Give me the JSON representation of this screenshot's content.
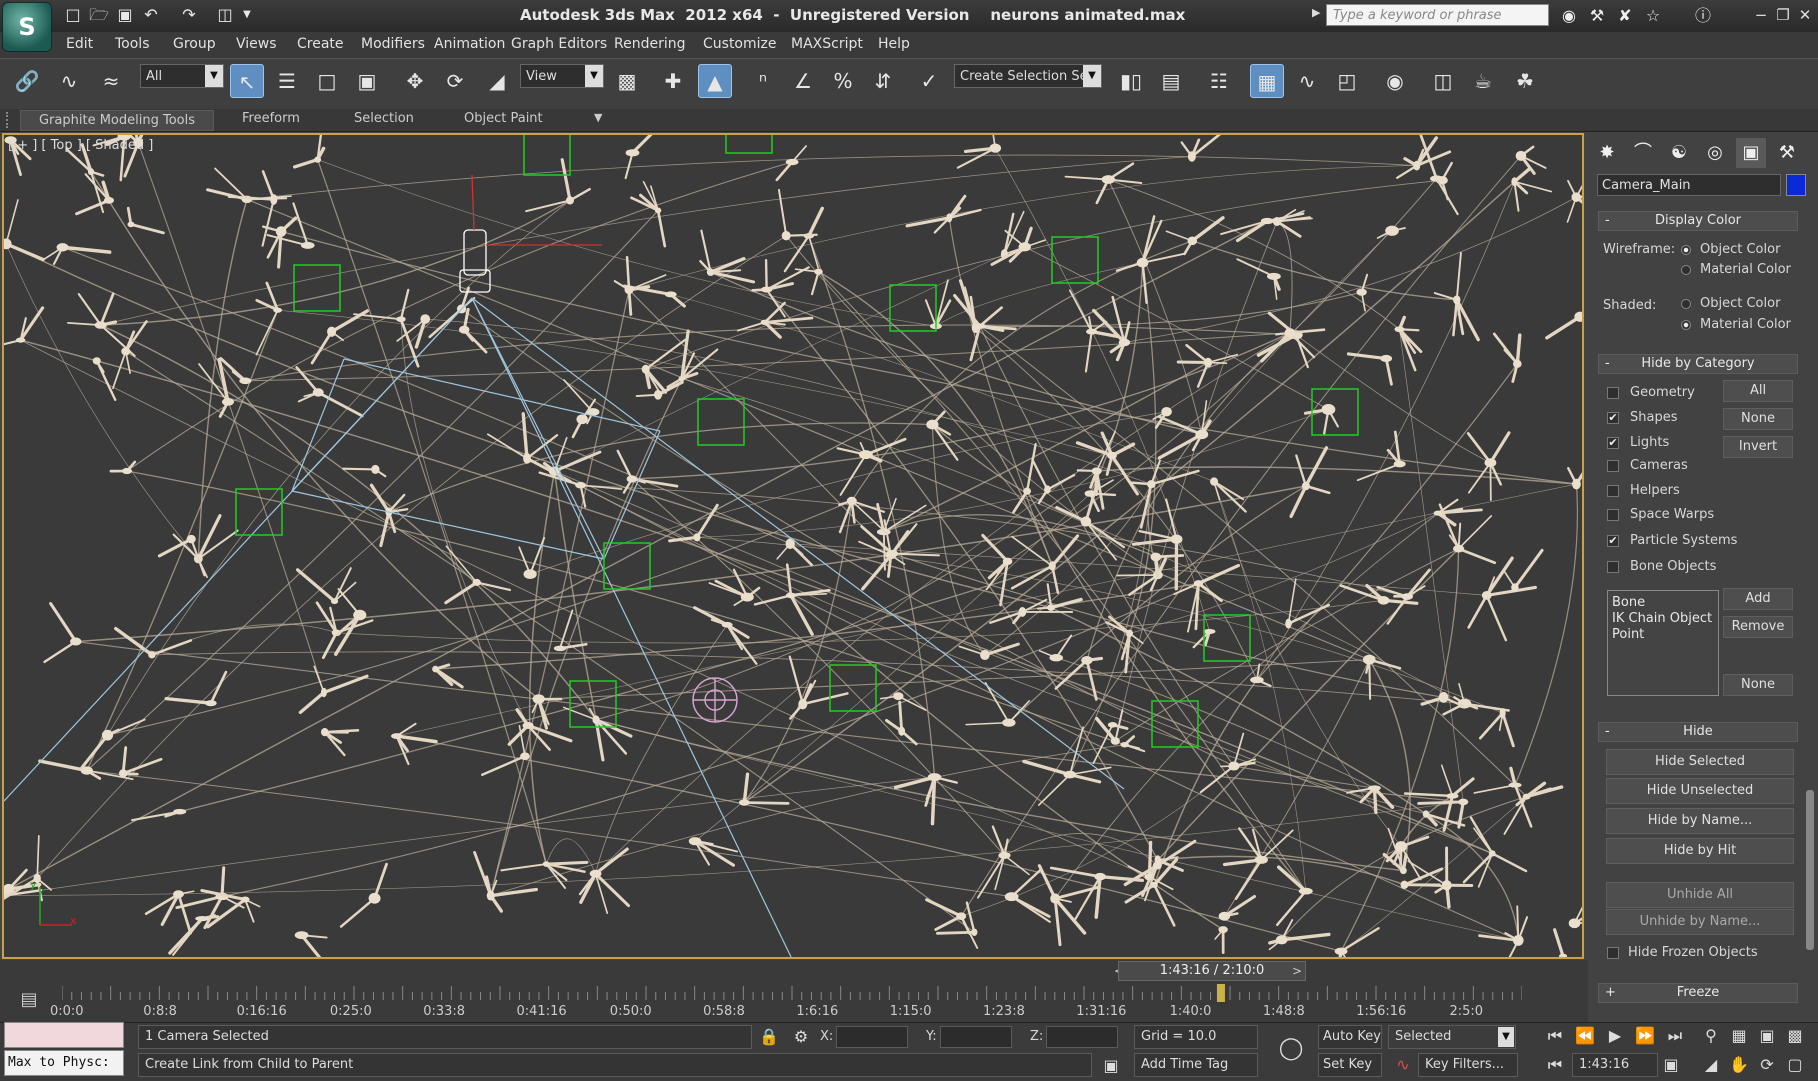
{
  "title_bar": {
    "title": "Autodesk 3ds Max  2012 x64  -  Unregistered Version    neurons animated.max",
    "search_placeholder": "Type a keyword or phrase",
    "logo": "S"
  },
  "menu": [
    "Edit",
    "Tools",
    "Group",
    "Views",
    "Create",
    "Modifiers",
    "Animation",
    "Graph Editors",
    "Rendering",
    "Customize",
    "MAXScript",
    "Help"
  ],
  "toolbar": {
    "filter_dropdown": "All",
    "coord_dropdown": "View",
    "selection_set": "Create Selection Se"
  },
  "ribbon_tabs": [
    "Graphite Modeling Tools",
    "Freeform",
    "Selection",
    "Object Paint"
  ],
  "viewport": {
    "label": "[ + ] [ Top ] [ Shaded ]",
    "axis_y": "y",
    "axis_x": "x"
  },
  "command_panel": {
    "object_name": "Camera_Main",
    "object_color": "#0a2ad8",
    "display_color": {
      "header": "Display Color",
      "collapse": "-",
      "wireframe_label": "Wireframe:",
      "shaded_label": "Shaded:",
      "opt_object": "Object Color",
      "opt_material": "Material Color"
    },
    "hide_by_category": {
      "header": "Hide by Category",
      "collapse": "-",
      "categories": [
        {
          "label": "Geometry",
          "checked": false
        },
        {
          "label": "Shapes",
          "checked": true
        },
        {
          "label": "Lights",
          "checked": true
        },
        {
          "label": "Cameras",
          "checked": false
        },
        {
          "label": "Helpers",
          "checked": false
        },
        {
          "label": "Space Warps",
          "checked": false
        },
        {
          "label": "Particle Systems",
          "checked": true
        },
        {
          "label": "Bone Objects",
          "checked": false
        }
      ],
      "btn_all": "All",
      "btn_none": "None",
      "btn_invert": "Invert",
      "list_items": [
        "Bone",
        "IK Chain Object",
        "Point"
      ],
      "btn_add": "Add",
      "btn_remove": "Remove",
      "btn_none2": "None"
    },
    "hide": {
      "header": "Hide",
      "collapse": "-",
      "buttons": [
        "Hide Selected",
        "Hide Unselected",
        "Hide by Name...",
        "Hide by Hit",
        "Unhide All",
        "Unhide by Name..."
      ],
      "frozen_label": "Hide Frozen Objects"
    },
    "freeze": {
      "header": "Freeze",
      "collapse": "+"
    }
  },
  "timeline": {
    "slider_label": "1:43:16 / 2:10:0",
    "prev": "<",
    "next": ">",
    "ticks": [
      "0:0:0",
      "0:8:8",
      "0:16:16",
      "0:25:0",
      "0:33:8",
      "0:41:16",
      "0:50:0",
      "0:58:8",
      "1:6:16",
      "1:15:0",
      "1:23:8",
      "1:31:16",
      "1:40:0",
      "1:48:8",
      "1:56:16",
      "2:5:0"
    ],
    "current_fraction": 0.7938
  },
  "status": {
    "maxscript_listener": "Max to Physc:",
    "selection_info": "1 Camera Selected",
    "prompt": "Create Link from Child to Parent",
    "x_label": "X:",
    "y_label": "Y:",
    "z_label": "Z:",
    "grid": "Grid = 10.0",
    "add_time_tag": "Add Time Tag",
    "auto_key": "Auto Key",
    "set_key": "Set Key",
    "key_mode": "Selected",
    "key_filters": "Key Filters...",
    "current_time": "1:43:16"
  }
}
